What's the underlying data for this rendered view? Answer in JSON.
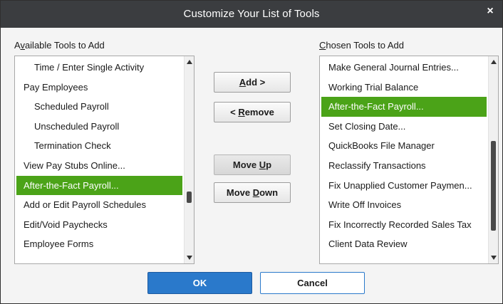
{
  "dialog": {
    "title": "Customize Your List of Tools",
    "close_glyph": "×"
  },
  "available": {
    "label_prefix": "A",
    "label_accel": "v",
    "label_rest": "ailable Tools to Add",
    "items": [
      {
        "label": "Time / Enter Single Activity",
        "indent": true,
        "selected": false
      },
      {
        "label": "Pay Employees",
        "indent": false,
        "selected": false
      },
      {
        "label": "Scheduled Payroll",
        "indent": true,
        "selected": false
      },
      {
        "label": "Unscheduled Payroll",
        "indent": true,
        "selected": false
      },
      {
        "label": "Termination Check",
        "indent": true,
        "selected": false
      },
      {
        "label": "View Pay Stubs Online...",
        "indent": false,
        "selected": false
      },
      {
        "label": "After-the-Fact Payroll...",
        "indent": false,
        "selected": true
      },
      {
        "label": "Add or Edit Payroll Schedules",
        "indent": false,
        "selected": false
      },
      {
        "label": "Edit/Void Paychecks",
        "indent": false,
        "selected": false
      },
      {
        "label": "Employee Forms",
        "indent": false,
        "selected": false
      }
    ],
    "scroll_position": 0.72
  },
  "chosen": {
    "label_accel": "C",
    "label_rest": "hosen Tools to Add",
    "items": [
      {
        "label": "Make General Journal Entries...",
        "selected": false
      },
      {
        "label": "Working Trial Balance",
        "selected": false
      },
      {
        "label": "After-the-Fact Payroll...",
        "selected": true
      },
      {
        "label": "Set Closing Date...",
        "selected": false
      },
      {
        "label": "QuickBooks File Manager",
        "selected": false
      },
      {
        "label": "Reclassify Transactions",
        "selected": false
      },
      {
        "label": "Fix Unapplied Customer Paymen...",
        "selected": false
      },
      {
        "label": "Write Off Invoices",
        "selected": false
      },
      {
        "label": "Fix Incorrectly Recorded Sales Tax",
        "selected": false
      },
      {
        "label": "Client Data Review",
        "selected": false
      }
    ],
    "scroll_position": 0.78
  },
  "buttons": {
    "add_accel": "A",
    "add_rest": "dd >",
    "remove_prefix": "< ",
    "remove_accel": "R",
    "remove_rest": "emove",
    "moveup_prefix": "Move ",
    "moveup_accel": "U",
    "moveup_rest": "p",
    "movedown_prefix": "Move ",
    "movedown_accel": "D",
    "movedown_rest": "own",
    "ok": "OK",
    "cancel": "Cancel"
  },
  "colors": {
    "selection": "#4ba318",
    "titlebar": "#3b3d40",
    "primary_button": "#2a79cb"
  }
}
